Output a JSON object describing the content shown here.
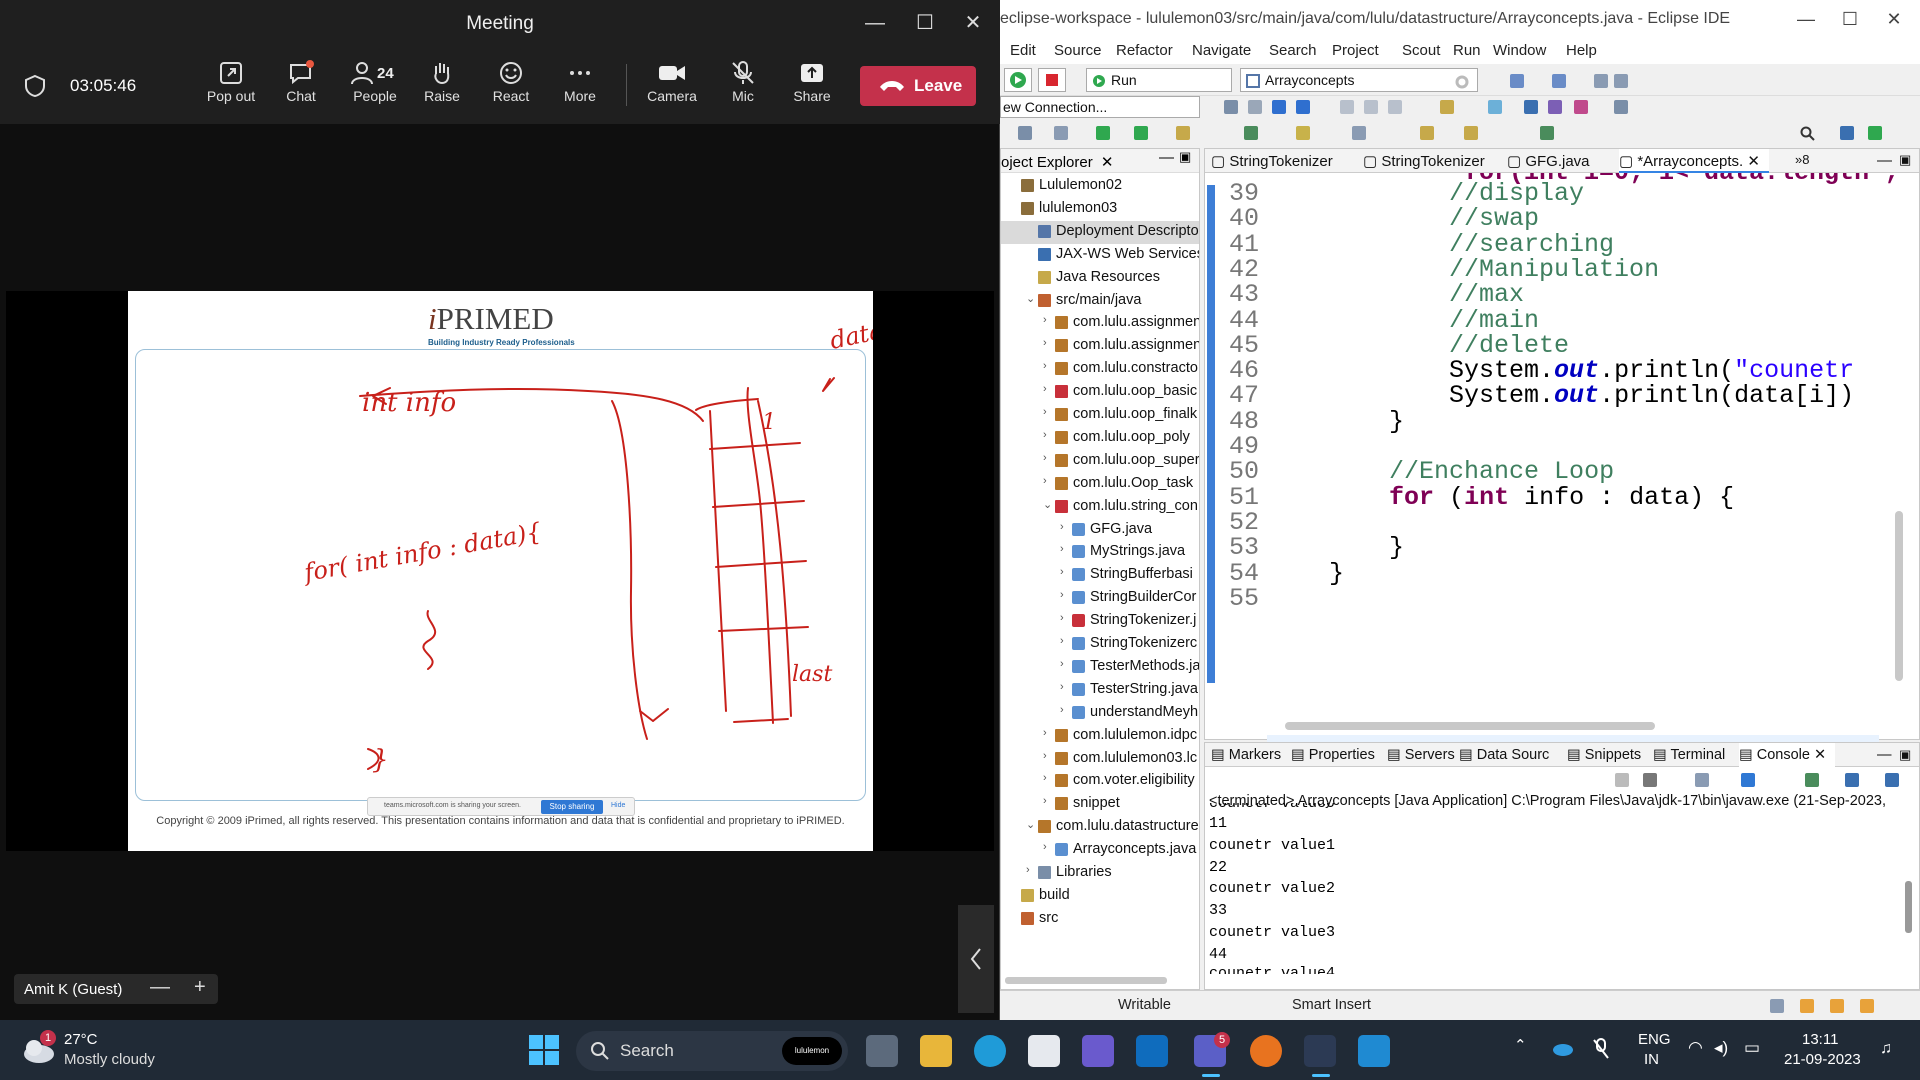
{
  "teams": {
    "window_title": "Meeting",
    "timer": "03:05:46",
    "toolbar": [
      {
        "id": "popout",
        "label": "Pop out"
      },
      {
        "id": "chat",
        "label": "Chat"
      },
      {
        "id": "people",
        "label": "People",
        "count": "24"
      },
      {
        "id": "raise",
        "label": "Raise"
      },
      {
        "id": "react",
        "label": "React"
      },
      {
        "id": "more",
        "label": "More"
      },
      {
        "id": "camera",
        "label": "Camera"
      },
      {
        "id": "mic",
        "label": "Mic"
      },
      {
        "id": "share",
        "label": "Share"
      }
    ],
    "leave_label": "Leave",
    "participant": "Amit K (Guest)",
    "zoom_out": "—",
    "zoom_in": "+",
    "slide": {
      "logo_i": "i",
      "logo_rest": "PRIMED",
      "tagline": "Building Industry Ready Professionals",
      "copyright": "Copyright © 2009 iPrimed, all rights reserved. This presentation contains information and data that is confidential and proprietary to iPRIMED.",
      "annotations": {
        "int_info": "int info",
        "data": "data",
        "for_loop": "for( int info : data){",
        "first": "1",
        "last": "last",
        "close_brace": "}"
      }
    },
    "share_bar": {
      "message": "teams.microsoft.com is sharing your screen.",
      "stop_label": "Stop sharing",
      "hide_label": "Hide"
    }
  },
  "eclipse": {
    "window_title": "eclipse-workspace - lululemon03/src/main/java/com/lulu/datastructure/Arrayconcepts.java - Eclipse IDE",
    "menu": [
      "Edit",
      "Source",
      "Refactor",
      "Navigate",
      "Search",
      "Project",
      "Scout",
      "Run",
      "Window",
      "Help"
    ],
    "run_combo": "Run",
    "launch_combo": "Arrayconcepts",
    "connection_combo": "ew Connection...",
    "project_explorer": {
      "title": "oject Explorer",
      "rows": [
        {
          "depth": 0,
          "label": "Lululemon02",
          "icon": "project"
        },
        {
          "depth": 0,
          "label": "lululemon03",
          "icon": "project"
        },
        {
          "depth": 1,
          "label": "Deployment Descriptor: lu",
          "icon": "descriptor",
          "selected": true
        },
        {
          "depth": 1,
          "label": "JAX-WS Web Services",
          "icon": "ws"
        },
        {
          "depth": 1,
          "label": "Java Resources",
          "icon": "jres"
        },
        {
          "depth": 1,
          "label": "src/main/java",
          "icon": "srcfolder",
          "expanded": true
        },
        {
          "depth": 2,
          "label": "com.lulu.assignmen",
          "icon": "package",
          "collapsed": true
        },
        {
          "depth": 2,
          "label": "com.lulu.assignmen",
          "icon": "package",
          "collapsed": true
        },
        {
          "depth": 2,
          "label": "com.lulu.constracto",
          "icon": "package",
          "collapsed": true
        },
        {
          "depth": 2,
          "label": "com.lulu.oop_basic",
          "icon": "package-err",
          "collapsed": true
        },
        {
          "depth": 2,
          "label": "com.lulu.oop_finalk",
          "icon": "package",
          "collapsed": true
        },
        {
          "depth": 2,
          "label": "com.lulu.oop_poly",
          "icon": "package",
          "collapsed": true
        },
        {
          "depth": 2,
          "label": "com.lulu.oop_super",
          "icon": "package",
          "collapsed": true
        },
        {
          "depth": 2,
          "label": "com.lulu.Oop_task",
          "icon": "package",
          "collapsed": true
        },
        {
          "depth": 2,
          "label": "com.lulu.string_con",
          "icon": "package-err",
          "expanded": true
        },
        {
          "depth": 3,
          "label": "GFG.java",
          "icon": "java",
          "collapsed": true
        },
        {
          "depth": 3,
          "label": "MyStrings.java",
          "icon": "java",
          "collapsed": true
        },
        {
          "depth": 3,
          "label": "StringBufferbasi",
          "icon": "java",
          "collapsed": true
        },
        {
          "depth": 3,
          "label": "StringBuilderCor",
          "icon": "java",
          "collapsed": true
        },
        {
          "depth": 3,
          "label": "StringTokenizer.j",
          "icon": "java-err",
          "collapsed": true
        },
        {
          "depth": 3,
          "label": "StringTokenizerc",
          "icon": "java",
          "collapsed": true
        },
        {
          "depth": 3,
          "label": "TesterMethods.ja",
          "icon": "java",
          "collapsed": true
        },
        {
          "depth": 3,
          "label": "TesterString.java",
          "icon": "java",
          "collapsed": true
        },
        {
          "depth": 3,
          "label": "understandMeyh",
          "icon": "java",
          "collapsed": true
        },
        {
          "depth": 2,
          "label": "com.lululemon.idpc",
          "icon": "package",
          "collapsed": true
        },
        {
          "depth": 2,
          "label": "com.lululemon03.lc",
          "icon": "package",
          "collapsed": true
        },
        {
          "depth": 2,
          "label": "com.voter.eligibility",
          "icon": "package",
          "collapsed": true
        },
        {
          "depth": 2,
          "label": "snippet",
          "icon": "package",
          "collapsed": true
        },
        {
          "depth": 1,
          "label": "com.lulu.datastructure",
          "icon": "package",
          "expanded": true
        },
        {
          "depth": 2,
          "label": "Arrayconcepts.java",
          "icon": "java",
          "collapsed": true
        },
        {
          "depth": 1,
          "label": "Libraries",
          "icon": "lib",
          "collapsed": true
        },
        {
          "depth": 0,
          "label": "build",
          "icon": "folder"
        },
        {
          "depth": 0,
          "label": "src",
          "icon": "srcfolder"
        }
      ]
    },
    "editor": {
      "tabs": [
        {
          "label": "StringTokenizer"
        },
        {
          "label": "StringTokenizer"
        },
        {
          "label": "GFG.java"
        },
        {
          "label": "*Arrayconcepts.",
          "active": true
        }
      ],
      "overflow": "»8",
      "top_partial": "for(int i=0; i< data.length ;",
      "lines": [
        {
          "n": "39",
          "c": [
            {
              "t": "            "
            },
            {
              "t": "//display",
              "k": "cmt"
            }
          ]
        },
        {
          "n": "40",
          "c": [
            {
              "t": "            "
            },
            {
              "t": "//swap",
              "k": "cmt"
            }
          ]
        },
        {
          "n": "41",
          "c": [
            {
              "t": "            "
            },
            {
              "t": "//searching",
              "k": "cmt"
            }
          ]
        },
        {
          "n": "42",
          "c": [
            {
              "t": "            "
            },
            {
              "t": "//Manipulation",
              "k": "cmt"
            }
          ]
        },
        {
          "n": "43",
          "c": [
            {
              "t": "            "
            },
            {
              "t": "//max",
              "k": "cmt"
            }
          ]
        },
        {
          "n": "44",
          "c": [
            {
              "t": "            "
            },
            {
              "t": "//main",
              "k": "cmt"
            }
          ]
        },
        {
          "n": "45",
          "c": [
            {
              "t": "            "
            },
            {
              "t": "//delete",
              "k": "cmt"
            }
          ]
        },
        {
          "n": "46",
          "c": [
            {
              "t": "            System."
            },
            {
              "t": "out",
              "k": "fld"
            },
            {
              "t": ".println("
            },
            {
              "t": "\"counetr",
              "k": "str"
            }
          ]
        },
        {
          "n": "47",
          "c": [
            {
              "t": "            System."
            },
            {
              "t": "out",
              "k": "fld"
            },
            {
              "t": ".println(data[i])"
            }
          ]
        },
        {
          "n": "48",
          "c": [
            {
              "t": "        }"
            }
          ]
        },
        {
          "n": "49",
          "c": [
            {
              "t": ""
            }
          ]
        },
        {
          "n": "50",
          "c": [
            {
              "t": "        "
            },
            {
              "t": "//Enchance Loop",
              "k": "cmt"
            }
          ]
        },
        {
          "n": "51",
          "c": [
            {
              "t": "        "
            },
            {
              "t": "for",
              "k": "kw"
            },
            {
              "t": " ("
            },
            {
              "t": "int",
              "k": "kw"
            },
            {
              "t": " info : data) {"
            }
          ]
        },
        {
          "n": "52",
          "c": [
            {
              "t": ""
            }
          ]
        },
        {
          "n": "53",
          "c": [
            {
              "t": "        }"
            }
          ]
        },
        {
          "n": "54",
          "c": [
            {
              "t": "    }"
            }
          ]
        },
        {
          "n": "55",
          "c": [
            {
              "t": ""
            }
          ]
        }
      ]
    },
    "console": {
      "tabs": [
        {
          "label": "Markers"
        },
        {
          "label": "Properties"
        },
        {
          "label": "Servers"
        },
        {
          "label": "Data Sourc"
        },
        {
          "label": "Snippets"
        },
        {
          "label": "Terminal"
        },
        {
          "label": "Console",
          "active": true
        }
      ],
      "terminated": "<terminated> Arrayconcepts [Java Application] C:\\Program Files\\Java\\jdk-17\\bin\\javaw.exe  (21-Sep-2023,",
      "top_partial": "counetr value0",
      "output": [
        "11",
        "counetr value1",
        "22",
        "counetr value2",
        "33",
        "counetr value3",
        "44"
      ],
      "bottom_partial": "counetr value4"
    },
    "status": {
      "writable": "Writable",
      "insert": "Smart Insert"
    }
  },
  "taskbar": {
    "weather_temp": "27°C",
    "weather_desc": "Mostly cloudy",
    "weather_badge": "1",
    "search_label": "Search",
    "search_chip": "lululemon",
    "teams_badge": "5",
    "lang1": "ENG",
    "lang2": "IN",
    "time": "13:11",
    "date": "21-09-2023"
  }
}
